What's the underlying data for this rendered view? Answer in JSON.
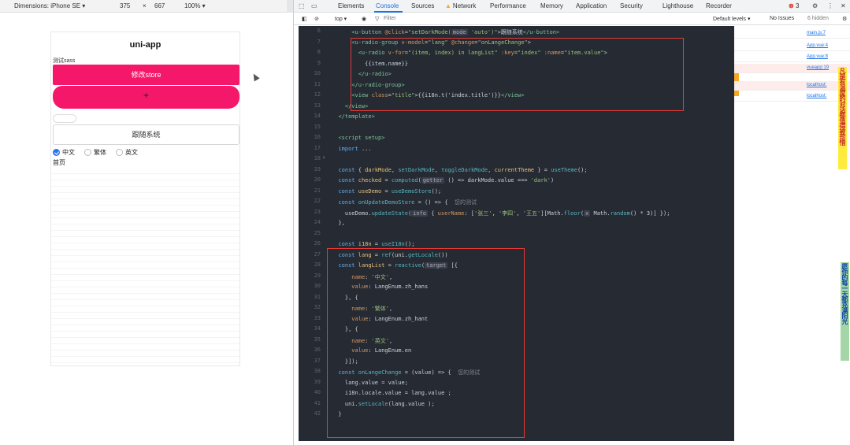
{
  "device_toolbar": {
    "dimensions_label": "Dimensions: iPhone SE ▾",
    "width": "375",
    "times": "×",
    "height": "667",
    "zoom": "100% ▾"
  },
  "app": {
    "title": "uni-app",
    "sass_label": "测试sass",
    "store_button": "修改store",
    "blob_plus": "+",
    "follow_button": "跟随系统",
    "radios": [
      {
        "label": "中文",
        "checked": true
      },
      {
        "label": "繁体",
        "checked": false
      },
      {
        "label": "英文",
        "checked": false
      }
    ],
    "home_label": "首页"
  },
  "devtools": {
    "tabs": [
      "Elements",
      "Console",
      "Sources",
      "Network",
      "Performance",
      "Memory",
      "Application",
      "Security",
      "Lighthouse",
      "Recorder"
    ],
    "active_tab": "Console",
    "error_count": "3",
    "toolbar": {
      "top": "top ▾",
      "filter": "Filter",
      "levels": "Default levels ▾",
      "issues": "No Issues",
      "hidden": "6 hidden"
    }
  },
  "editor": {
    "lines": [
      {
        "n": "6",
        "html": "      <span class='t-tag'>&lt;u-button</span> <span class='t-attr'>@click</span>=<span class='t-str'>\"setDarkMode(</span><span class='t-chip'>mode</span> <span class='t-str'>'auto')\"</span>&gt;跟随系统<span class='t-tag'>&lt;/u-button&gt;</span>"
      },
      {
        "n": "7",
        "html": "      <span class='t-tag'>&lt;u-radio-group</span> <span class='t-attr'>v-model</span>=<span class='t-str'>\"lang\"</span> <span class='t-attr'>@change</span>=<span class='t-str'>\"onLangeChange\"</span>&gt;"
      },
      {
        "n": "8",
        "html": "        <span class='t-tag'>&lt;u-radio</span> <span class='t-attr'>v-for</span>=<span class='t-str'>\"(item, index) in langList\"</span> <span class='t-attr'>:key</span>=<span class='t-str'>\"index\"</span> <span class='t-attr'>:name</span>=<span class='t-str'>\"item.value\"</span>&gt;"
      },
      {
        "n": "9",
        "html": "          {{item.name}}"
      },
      {
        "n": "10",
        "html": "        <span class='t-tag'>&lt;/u-radio&gt;</span>"
      },
      {
        "n": "11",
        "html": "      <span class='t-tag'>&lt;/u-radio-group&gt;</span>"
      },
      {
        "n": "12",
        "html": "      <span class='t-tag'>&lt;view</span> <span class='t-attr'>class</span>=<span class='t-str'>\"title\"</span>&gt;{{i18n.t('index.title')}}<span class='t-tag'>&lt;/view&gt;</span>"
      },
      {
        "n": "13",
        "html": "    <span class='t-tag'>&lt;/view&gt;</span>"
      },
      {
        "n": "14",
        "html": "  <span class='t-tag'>&lt;/template&gt;</span>"
      },
      {
        "n": "15",
        "html": ""
      },
      {
        "n": "16",
        "html": "  <span class='t-tag'>&lt;script setup&gt;</span>"
      },
      {
        "n": "17",
        "html": "  <span class='t-kw'>import</span> ..."
      },
      {
        "n": "18",
        "html": ""
      },
      {
        "n": "19",
        "html": "  <span class='t-kw'>const</span> { <span class='t-var'>darkMode</span>, <span class='t-fn'>setDarkMode</span>, <span class='t-fn'>toggleDarkMode</span>, <span class='t-var'>currentTheme</span> } = <span class='t-fn'>useTheme</span>();"
      },
      {
        "n": "20",
        "html": "  <span class='t-kw'>const</span> <span class='t-var'>checked</span> = <span class='t-fn'>computed</span>(<span class='t-chip'>getter</span> () =&gt; darkMode.value === <span class='t-str'>'dark'</span>)"
      },
      {
        "n": "21",
        "html": "  <span class='t-kw'>const</span> <span class='t-var'>useDemo</span> = <span class='t-fn'>useDemoStore</span>();"
      },
      {
        "n": "22",
        "html": "  <span class='t-kw'>const</span> <span class='t-fn'>onUpdateDemoStore</span> = () =&gt; {  <span class='t-cm'>您的测试</span>"
      },
      {
        "n": "23",
        "html": "    useDemo.<span class='t-fn'>updateState</span>(<span class='t-chip'>info</span> { <span class='t-attr'>userName</span>: [<span class='t-str'>'张三'</span>, <span class='t-str'>'李四'</span>, <span class='t-str'>'王五'</span>][Math.<span class='t-fn'>floor</span>(<span class='t-chip'>x</span> Math.<span class='t-fn'>random</span>() * 3)] });"
      },
      {
        "n": "24",
        "html": "  },"
      },
      {
        "n": "25",
        "html": ""
      },
      {
        "n": "26",
        "html": "  <span class='t-kw'>const</span> <span class='t-var'>i18n</span> = <span class='t-fn'>useI18n</span>();"
      },
      {
        "n": "27",
        "html": "  <span class='t-kw'>const</span> <span class='t-var'>lang</span> = <span class='t-fn'>ref</span>(uni.<span class='t-fn'>getLocale</span>())"
      },
      {
        "n": "28",
        "html": "  <span class='t-kw'>const</span> <span class='t-var'>langList</span> = <span class='t-fn'>reactive</span>(<span class='t-chip'>target</span> [{"
      },
      {
        "n": "29",
        "html": "      <span class='t-attr'>name</span>: <span class='t-str'>'中文'</span>,"
      },
      {
        "n": "30",
        "html": "      <span class='t-attr'>value</span>: LangEnum.zh_hans"
      },
      {
        "n": "31",
        "html": "    }, {"
      },
      {
        "n": "32",
        "html": "      <span class='t-attr'>name</span>: <span class='t-str'>'繁体'</span>,"
      },
      {
        "n": "33",
        "html": "      <span class='t-attr'>value</span>: LangEnum.zh_hant"
      },
      {
        "n": "34",
        "html": "    }, {"
      },
      {
        "n": "35",
        "html": "      <span class='t-attr'>name</span>: <span class='t-str'>'英文'</span>,"
      },
      {
        "n": "36",
        "html": "      <span class='t-attr'>value</span>: LangEnum.en"
      },
      {
        "n": "37",
        "html": "    }]);"
      },
      {
        "n": "38",
        "html": "  <span class='t-kw'>const</span> <span class='t-fn'>onLangeChange</span> = (value) =&gt; {  <span class='t-cm'>您的测试</span>"
      },
      {
        "n": "39",
        "html": "    lang.value = value;"
      },
      {
        "n": "40",
        "html": "    i18n.locale.value = lang.value ;"
      },
      {
        "n": "41",
        "html": "    uni.<span class='t-fn'>setLocale</span>(lang.value );"
      },
      {
        "n": "42",
        "html": "  }"
      }
    ]
  },
  "console_side": {
    "links": [
      "main.js:7",
      "App.vue:4",
      "App.vue:8",
      "vueapp:19",
      "localhost:",
      "localhost:"
    ],
    "vertical_text_1": "凡是有温度的对话都值得被珍惜",
    "vertical_text_2": "愿你的每一天都充满阳光"
  }
}
